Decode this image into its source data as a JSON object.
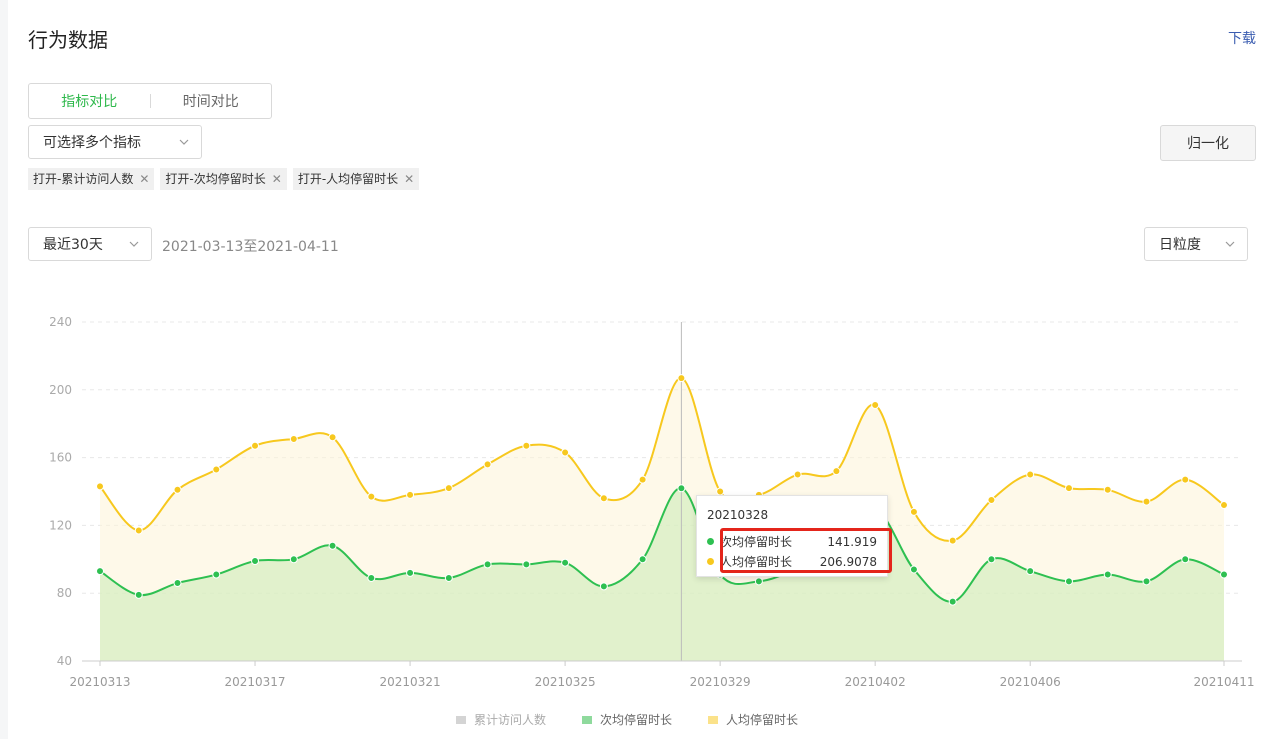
{
  "header": {
    "title": "行为数据",
    "download": "下载"
  },
  "compare_tabs": [
    "指标对比",
    "时间对比"
  ],
  "metric_select": {
    "placeholder": "可选择多个指标"
  },
  "selected_tags": [
    "打开-累计访问人数",
    "打开-次均停留时长",
    "打开-人均停留时长"
  ],
  "normalize_button": "归一化",
  "period_select": "最近30天",
  "date_range": "2021-03-13至2021-04-11",
  "granularity_select": "日粒度",
  "colors": {
    "accent": "#2eb84b",
    "green": "#2ec051",
    "yellow": "#f7c81e",
    "grey": "#d4d4d4"
  },
  "tooltip": {
    "date": "20210328",
    "rows": [
      {
        "label": "次均停留时长",
        "value": "141.919",
        "color": "#2ec051"
      },
      {
        "label": "人均停留时长",
        "value": "206.9078",
        "color": "#f7c81e"
      }
    ]
  },
  "chart_data": {
    "type": "area",
    "x": [
      "20210313",
      "20210314",
      "20210315",
      "20210316",
      "20210317",
      "20210318",
      "20210319",
      "20210320",
      "20210321",
      "20210322",
      "20210323",
      "20210324",
      "20210325",
      "20210326",
      "20210327",
      "20210328",
      "20210329",
      "20210330",
      "20210331",
      "20210401",
      "20210402",
      "20210403",
      "20210404",
      "20210405",
      "20210406",
      "20210407",
      "20210408",
      "20210409",
      "20210410",
      "20210411"
    ],
    "x_tick_labels": [
      "20210313",
      "20210317",
      "20210321",
      "20210325",
      "20210329",
      "20210402",
      "20210406",
      "20210411"
    ],
    "ylim": [
      40,
      240
    ],
    "y_ticks": [
      40,
      80,
      120,
      160,
      200,
      240
    ],
    "grid": true,
    "legend_position": "bottom",
    "series": [
      {
        "name": "累计访问人数",
        "values": [],
        "color": "#d4d4d4"
      },
      {
        "name": "次均停留时长",
        "color": "#2ec051",
        "values": [
          93,
          79,
          86,
          91,
          99,
          100,
          108,
          89,
          92,
          89,
          97,
          97,
          98,
          84,
          100,
          141.919,
          91,
          87,
          94,
          100,
          129,
          94,
          75,
          100,
          93,
          87,
          91,
          87,
          100,
          91
        ]
      },
      {
        "name": "人均停留时长",
        "color": "#f7c81e",
        "values": [
          143,
          117,
          141,
          153,
          167,
          171,
          172,
          137,
          138,
          142,
          156,
          167,
          163,
          136,
          147,
          206.9078,
          140,
          138,
          150,
          152,
          191,
          128,
          111,
          135,
          150,
          142,
          141,
          134,
          147,
          132
        ]
      }
    ]
  }
}
